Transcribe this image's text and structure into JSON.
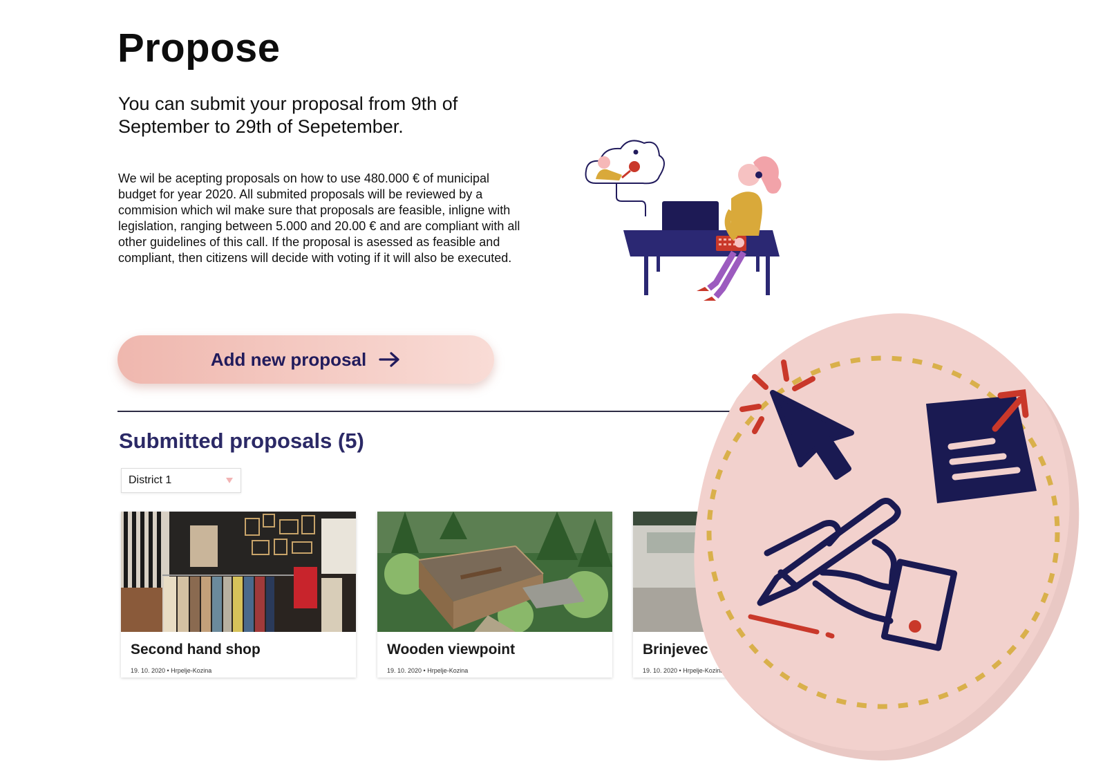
{
  "page": {
    "title": "Propose",
    "headline": "You can submit your proposal from 9th of September to 29th of Sepetember.",
    "intro": "We wil be acepting proposals on how to use 480.000 € of municipal budget for year 2020. All submited proposals will be reviewed by a commision which wil make sure that proposals are feasible, inligne with legislation, ranging between 5.000 and 20.00 € and are compliant with all other guidelines of this call. If the proposal is asessed as feasible and compliant, then citizens will decide with voting if it will also be executed."
  },
  "cta": {
    "label": "Add new proposal",
    "icon": "arrow-right-icon"
  },
  "submitted": {
    "title": "Submitted proposals (5)",
    "filter": {
      "selected": "District 1",
      "icon": "caret-down-icon"
    },
    "cards": [
      {
        "title": "Second hand shop",
        "date": "19. 10. 2020",
        "location": "Hrpelje-Kozina",
        "image": "clothing-store-photo"
      },
      {
        "title": "Wooden viewpoint",
        "date": "19. 10. 2020",
        "location": "Hrpelje-Kozina",
        "image": "forest-deck-photo"
      },
      {
        "title": "Brinjevec Fou",
        "date": "19. 10. 2020",
        "location": "Hrpelje-Kozina",
        "image": "stone-fountain-photo"
      }
    ]
  },
  "colors": {
    "accent_navy": "#211b5c",
    "button_pink": "#efb7ae",
    "blob_pink": "#f2cfcb",
    "icon_red": "#c9382a",
    "dotted_gold": "#d9b04b"
  }
}
